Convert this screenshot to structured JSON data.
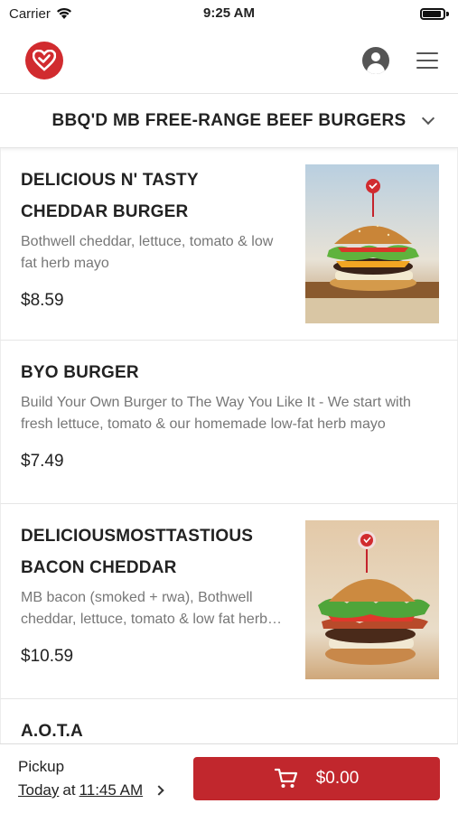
{
  "status_bar": {
    "carrier": "Carrier",
    "time": "9:25 AM"
  },
  "header": {
    "logo_icon": "heart-logo-icon",
    "account_icon": "account-icon",
    "menu_icon": "hamburger-menu-icon"
  },
  "category": {
    "title": "BBQ'D MB FREE-RANGE BEEF BURGERS"
  },
  "items": [
    {
      "name": "DELICIOUS N' TASTY CHEDDAR BURGER",
      "description": "Bothwell cheddar, lettuce, tomato & low fat herb mayo",
      "price": "$8.59",
      "has_image": true
    },
    {
      "name": "BYO BURGER",
      "description": "Build Your Own Burger to The Way You Like It - We start with fresh lettuce, tomato & our homemade low-fat herb mayo",
      "price": "$7.49",
      "has_image": false
    },
    {
      "name": "DELICIOUSMOSTTASTIOUS BACON CHEDDAR",
      "description": "MB bacon (smoked + rwa), Bothwell cheddar, lettuce, tomato & low fat herb mayo",
      "price": "$10.59",
      "has_image": true
    },
    {
      "name": "A.O.T.A",
      "description": "",
      "price": "",
      "has_image": false
    }
  ],
  "bottom": {
    "pickup_label": "Pickup",
    "day": "Today",
    "at": "at",
    "time": "11:45 AM",
    "cart_total": "$0.00"
  },
  "colors": {
    "brand_red": "#c1272d",
    "logo_red": "#d12b2f"
  }
}
